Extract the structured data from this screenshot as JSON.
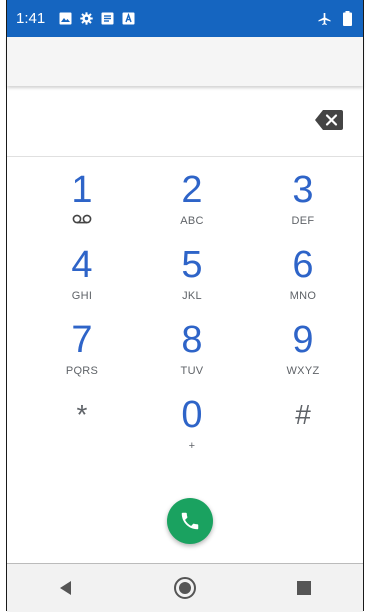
{
  "status_bar": {
    "time": "1:41",
    "icons": [
      "image-icon",
      "settings-icon",
      "notes-icon",
      "text-icon"
    ],
    "right_icons": [
      "airplane-mode-icon",
      "battery-icon"
    ]
  },
  "keypad": [
    {
      "digit": "1",
      "letters": "",
      "sub_icon": "voicemail-icon"
    },
    {
      "digit": "2",
      "letters": "ABC"
    },
    {
      "digit": "3",
      "letters": "DEF"
    },
    {
      "digit": "4",
      "letters": "GHI"
    },
    {
      "digit": "5",
      "letters": "JKL"
    },
    {
      "digit": "6",
      "letters": "MNO"
    },
    {
      "digit": "7",
      "letters": "PQRS"
    },
    {
      "digit": "8",
      "letters": "TUV"
    },
    {
      "digit": "9",
      "letters": "WXYZ"
    },
    {
      "digit": "*",
      "letters": ""
    },
    {
      "digit": "0",
      "letters": "+"
    },
    {
      "digit": "#",
      "letters": ""
    }
  ],
  "colors": {
    "status_bar": "#1565c0",
    "digit": "#2e64c8",
    "call_button": "#1aa260"
  },
  "nav": [
    "back-icon",
    "home-icon",
    "recents-icon"
  ]
}
